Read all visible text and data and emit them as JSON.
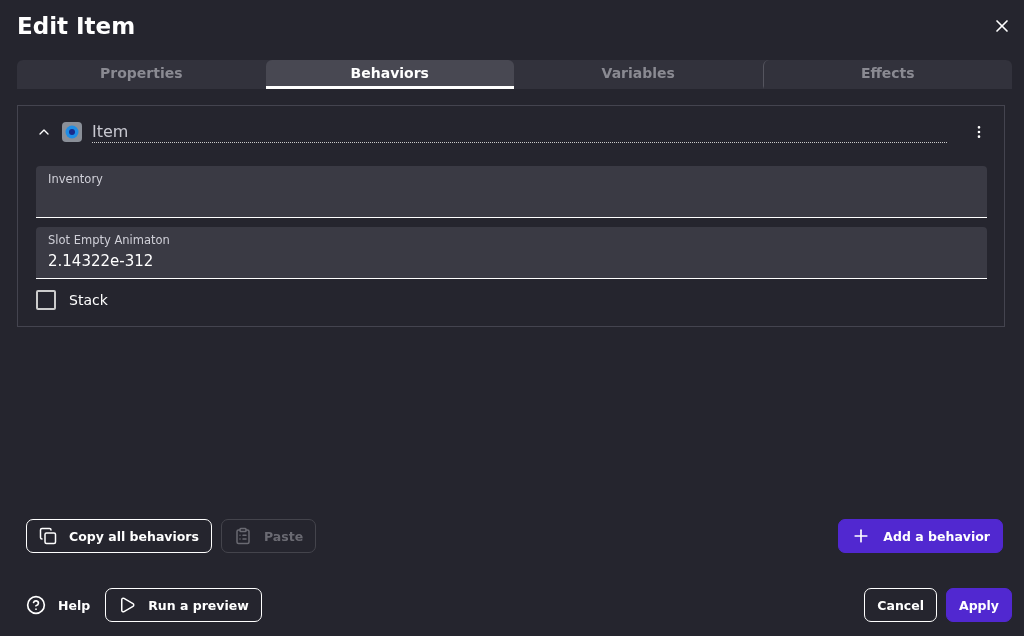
{
  "window": {
    "title": "Edit Item"
  },
  "tabs": [
    {
      "label": "Properties",
      "selected": false
    },
    {
      "label": "Behaviors",
      "selected": true
    },
    {
      "label": "Variables",
      "selected": false
    },
    {
      "label": "Effects",
      "selected": false
    }
  ],
  "behavior": {
    "name": "Item",
    "expanded": true,
    "fields": [
      {
        "kind": "text",
        "label": "Inventory"
      },
      {
        "kind": "text",
        "label": "Slot Empty Animaton",
        "value": "2.14322e-312"
      },
      {
        "kind": "checkbox",
        "label": "Stack",
        "checked": false
      }
    ]
  },
  "actions": [
    {
      "label": "Copy all behaviors",
      "disabled": false
    },
    {
      "label": "Paste",
      "disabled": true
    }
  ],
  "add_button": "Add a behavior",
  "footer": {
    "help": "Help",
    "preview": "Run a preview",
    "cancel": "Cancel",
    "apply": "Apply"
  }
}
